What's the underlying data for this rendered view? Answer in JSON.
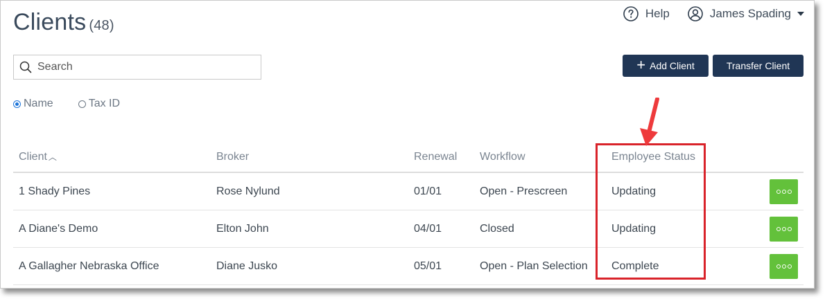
{
  "header": {
    "title": "Clients",
    "count": "(48)"
  },
  "topnav": {
    "help_label": "Help",
    "user_name": "James Spading"
  },
  "search": {
    "placeholder": "Search"
  },
  "toolbar": {
    "add_label": "Add Client",
    "transfer_label": "Transfer Client"
  },
  "search_mode": {
    "options": [
      "Name",
      "Tax ID"
    ],
    "selected": "Name"
  },
  "table": {
    "columns": [
      "Client",
      "Broker",
      "Renewal",
      "Workflow",
      "Employee Status"
    ],
    "rows": [
      {
        "client": "1 Shady Pines",
        "broker": "Rose Nylund",
        "renewal": "01/01",
        "workflow": "Open - Prescreen",
        "status": "Updating"
      },
      {
        "client": "A Diane's Demo",
        "broker": "Elton John",
        "renewal": "04/01",
        "workflow": "Closed",
        "status": "Updating"
      },
      {
        "client": "A Gallagher Nebraska Office",
        "broker": "Diane Jusko",
        "renewal": "05/01",
        "workflow": "Open - Plan Selection",
        "status": "Complete"
      }
    ]
  },
  "icons": {
    "help": "help-circle-icon",
    "user": "user-circle-icon",
    "search": "search-icon",
    "add": "plus-icon",
    "sort": "chevron-up-icon",
    "more": "more-dots-icon"
  },
  "colors": {
    "primary_button": "#203655",
    "action_button": "#63c13b",
    "annotation": "#d9232a",
    "radio_selected": "#1a73d9"
  }
}
